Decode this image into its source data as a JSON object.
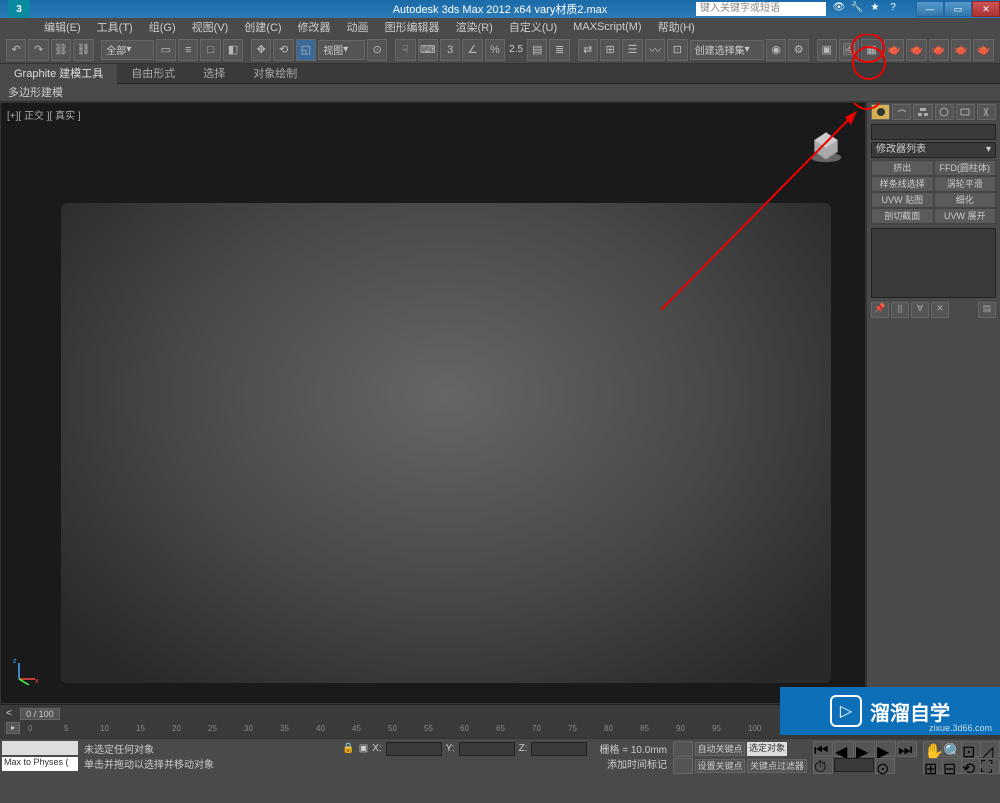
{
  "title": "Autodesk 3ds Max 2012 x64     vary材质2.max",
  "search_placeholder": "键入关键字或短语",
  "app_icon": "3",
  "menus": [
    "编辑(E)",
    "工具(T)",
    "组(G)",
    "视图(V)",
    "创建(C)",
    "修改器",
    "动画",
    "图形编辑器",
    "渲染(R)",
    "自定义(U)",
    "MAXScript(M)",
    "帮助(H)"
  ],
  "toolbar": {
    "all_dropdown": "全部",
    "view_dropdown": "视图",
    "snap_value": "2.5",
    "selection_set": "创建选择集"
  },
  "ribbon": {
    "tabs": [
      "Graphite 建模工具",
      "自由形式",
      "选择",
      "对象绘制"
    ],
    "sub": "多边形建模"
  },
  "viewport": {
    "label": "[+][ 正交 ][ 真实 ]"
  },
  "cmd_panel": {
    "modifier_list": "修改器列表",
    "buttons": [
      "挤出",
      "FFD(圆柱体)",
      "样条线选择",
      "涡轮平滑",
      "UVW 贴图",
      "细化",
      "剖切截面",
      "UVW 展开"
    ]
  },
  "timeline": {
    "slider": "0 / 100",
    "ticks": [
      "0",
      "5",
      "10",
      "15",
      "20",
      "25",
      "30",
      "35",
      "40",
      "45",
      "50",
      "55",
      "60",
      "65",
      "70",
      "75",
      "80",
      "85",
      "90",
      "95",
      "100"
    ]
  },
  "status": {
    "script": "Max to Physes (",
    "sel_msg": "未选定任何对象",
    "hint": "单击并拖动以选择并移动对象",
    "x": "X:",
    "y": "Y:",
    "z": "Z:",
    "grid": "栅格 = 10.0mm",
    "auto_key": "自动关键点",
    "sel_obj": "选定对象",
    "add_time": "添加时间标记",
    "set_key": "设置关键点",
    "key_filter": "关键点过滤器"
  },
  "watermark": {
    "text": "溜溜自学",
    "url": "zixue.3d66.com"
  }
}
